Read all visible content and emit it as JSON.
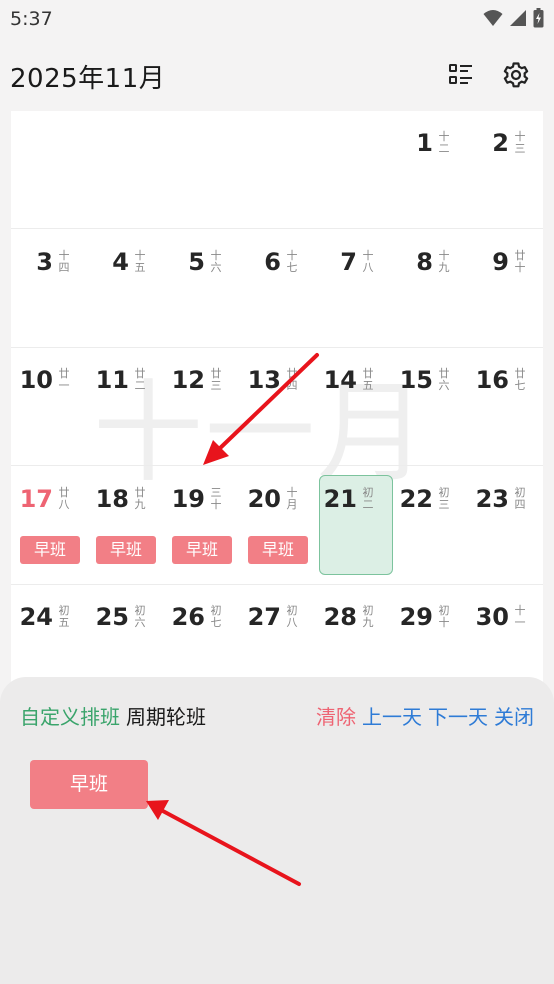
{
  "status_bar": {
    "time": "5:37"
  },
  "header": {
    "title": "2025年11月",
    "list_icon": "list-view-icon",
    "settings_icon": "gear-icon"
  },
  "calendar": {
    "watermark": "十一月",
    "weeks": [
      [
        {
          "day": "",
          "lunar": ""
        },
        {
          "day": "",
          "lunar": ""
        },
        {
          "day": "",
          "lunar": ""
        },
        {
          "day": "",
          "lunar": ""
        },
        {
          "day": "",
          "lunar": ""
        },
        {
          "day": "1",
          "lunar": "十二"
        },
        {
          "day": "2",
          "lunar": "十三"
        }
      ],
      [
        {
          "day": "3",
          "lunar": "十四"
        },
        {
          "day": "4",
          "lunar": "十五"
        },
        {
          "day": "5",
          "lunar": "十六"
        },
        {
          "day": "6",
          "lunar": "十七"
        },
        {
          "day": "7",
          "lunar": "十八"
        },
        {
          "day": "8",
          "lunar": "十九"
        },
        {
          "day": "9",
          "lunar": "廿十"
        }
      ],
      [
        {
          "day": "10",
          "lunar": "廿一"
        },
        {
          "day": "11",
          "lunar": "廿二"
        },
        {
          "day": "12",
          "lunar": "廿三"
        },
        {
          "day": "13",
          "lunar": "廿四"
        },
        {
          "day": "14",
          "lunar": "廿五"
        },
        {
          "day": "15",
          "lunar": "廿六"
        },
        {
          "day": "16",
          "lunar": "廿七"
        }
      ],
      [
        {
          "day": "17",
          "lunar": "廿八",
          "red": true,
          "shift": "早班"
        },
        {
          "day": "18",
          "lunar": "廿九",
          "shift": "早班"
        },
        {
          "day": "19",
          "lunar": "三十",
          "shift": "早班"
        },
        {
          "day": "20",
          "lunar": "十月",
          "shift": "早班"
        },
        {
          "day": "21",
          "lunar": "初二",
          "today": true
        },
        {
          "day": "22",
          "lunar": "初三"
        },
        {
          "day": "23",
          "lunar": "初四"
        }
      ],
      [
        {
          "day": "24",
          "lunar": "初五"
        },
        {
          "day": "25",
          "lunar": "初六"
        },
        {
          "day": "26",
          "lunar": "初七"
        },
        {
          "day": "27",
          "lunar": "初八"
        },
        {
          "day": "28",
          "lunar": "初九"
        },
        {
          "day": "29",
          "lunar": "初十"
        },
        {
          "day": "30",
          "lunar": "十一"
        }
      ]
    ]
  },
  "panel": {
    "tab_custom": "自定义排班",
    "tab_cycle": "周期轮班",
    "clear": "清除",
    "prev_day": "上一天",
    "next_day": "下一天",
    "close": "关闭",
    "shift_option": "早班"
  },
  "colors": {
    "shift_badge": "#f27f86",
    "today_fill": "#dcefe5",
    "today_border": "#7cc39d",
    "accent_green": "#3aa46b",
    "accent_blue": "#2e7bd6",
    "accent_red": "#ee6473",
    "annotation_arrow": "#e8141c"
  }
}
